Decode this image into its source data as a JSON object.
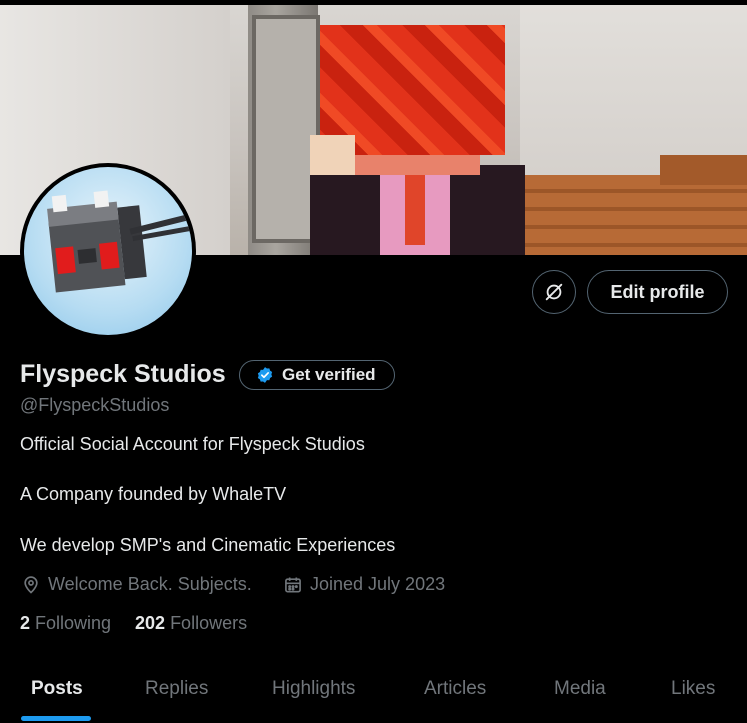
{
  "profile": {
    "name": "Flyspeck Studios",
    "handle": "@FlyspeckStudios",
    "verify_label": "Get verified",
    "edit_label": "Edit profile",
    "bio": [
      "Official Social Account for Flyspeck Studios",
      "A Company founded by WhaleTV",
      "We develop SMP's and Cinematic Experiences"
    ],
    "location": "Welcome Back. Subjects.",
    "joined": "Joined July 2023",
    "following_count": "2",
    "following_label": "Following",
    "followers_count": "202",
    "followers_label": "Followers"
  },
  "tabs": [
    "Posts",
    "Replies",
    "Highlights",
    "Articles",
    "Media",
    "Likes"
  ],
  "active_tab": "Posts",
  "icons": {
    "spaces": "spaces-icon",
    "verified": "verified-badge-icon",
    "location": "location-pin-icon",
    "calendar": "calendar-icon"
  },
  "colors": {
    "background": "#000000",
    "text": "#e7e9ea",
    "muted": "#71767b",
    "border": "#536471",
    "accent": "#1d9bf0"
  }
}
